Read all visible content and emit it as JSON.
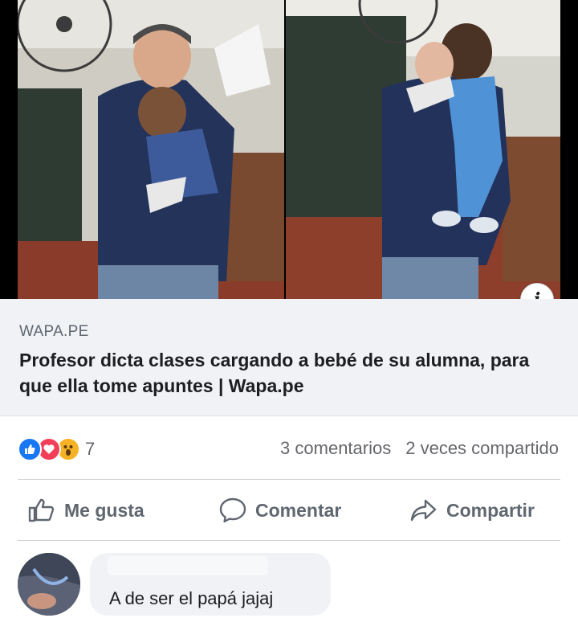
{
  "post": {
    "photo_left_description": "teacher holding baby",
    "photo_right_description": "teacher holding baby"
  },
  "link_preview": {
    "domain": "WAPA.PE",
    "title": "Profesor dicta clases cargando a bebé de su alumna, para que ella tome apuntes | Wapa.pe",
    "info_icon": "info-icon"
  },
  "reactions": {
    "icons": [
      "like-reaction-icon",
      "love-reaction-icon",
      "wow-reaction-icon"
    ],
    "count": "7",
    "comments": "3 comentarios",
    "shares": "2 veces compartido"
  },
  "actions": {
    "like_label": "Me gusta",
    "comment_label": "Comentar",
    "share_label": "Compartir"
  },
  "comment": {
    "author": "",
    "text": "A de ser el papá jajaj"
  },
  "colors": {
    "link_bg": "#f0f2f5",
    "text_secondary": "#65676b",
    "like_blue": "#1877f2",
    "love_red": "#f33e58",
    "wow_yellow": "#f7b125"
  }
}
